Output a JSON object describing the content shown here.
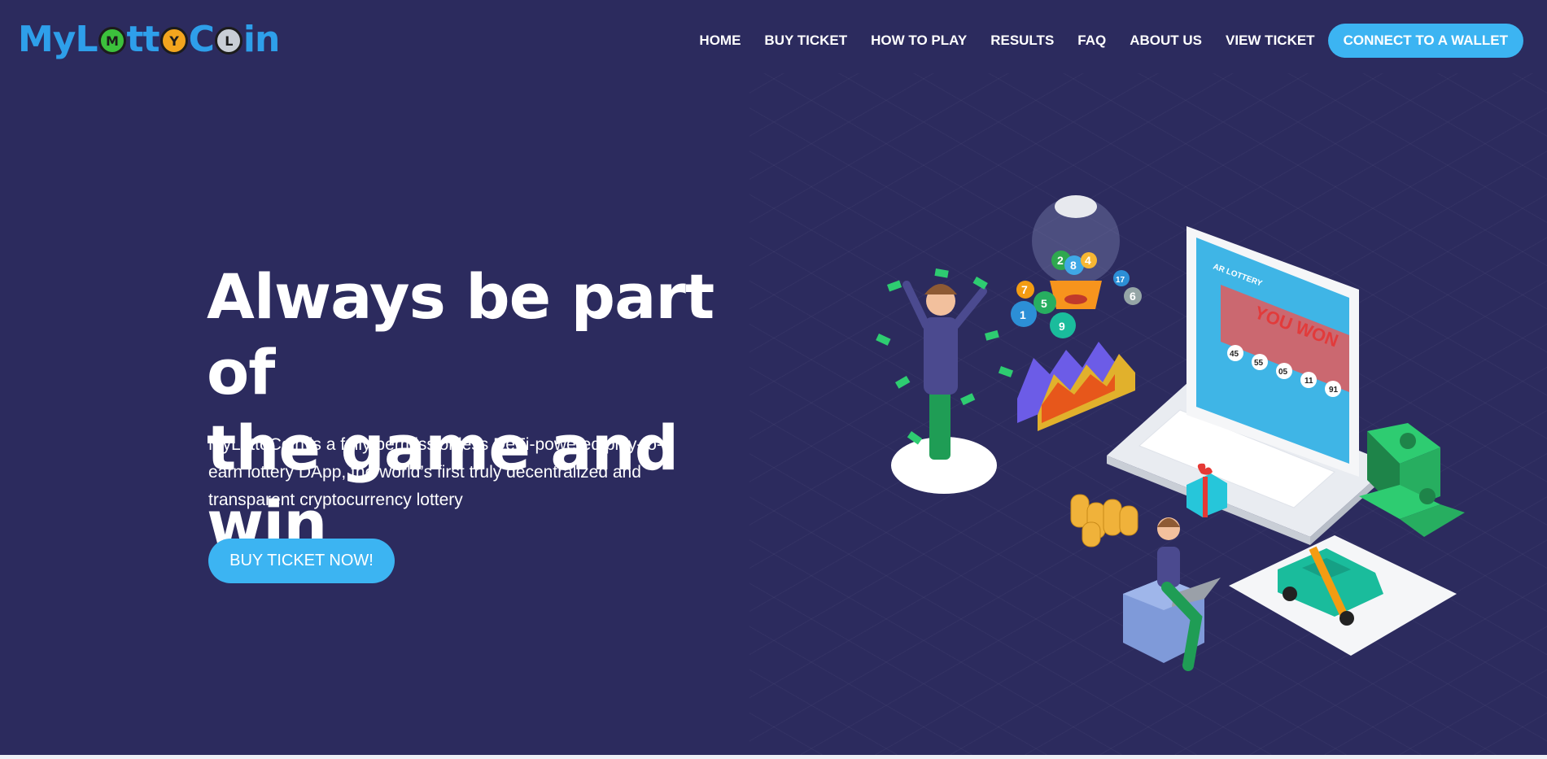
{
  "brand": {
    "prefix": "MyL",
    "coin1": "M",
    "middle": "tt",
    "coin2": "Y",
    "c_letter": "C",
    "coin3": "L",
    "suffix": "in"
  },
  "nav": {
    "items": [
      "HOME",
      "BUY TICKET",
      "HOW TO PLAY",
      "RESULTS",
      "FAQ",
      "ABOUT US",
      "VIEW TICKET"
    ],
    "wallet_label": "CONNECT TO A WALLET"
  },
  "hero": {
    "title_line1": "Always be part of",
    "title_line2": "the game and win",
    "description": "MyLottoCoin is a fully permissionless DeFi-powered play-to-earn lottery DApp, the world’s first truly decentralized and transparent cryptocurrency lottery",
    "cta_label": "BUY TICKET NOW!"
  },
  "illustration": {
    "screen_brand": "AR LOTTERY",
    "screen_message": "YOU WON",
    "winning_numbers": [
      "45",
      "55",
      "05",
      "11",
      "91"
    ],
    "balls": [
      "2",
      "8",
      "4",
      "7",
      "5",
      "1",
      "9",
      "17",
      "6"
    ]
  },
  "colors": {
    "background": "#2c2b5e",
    "accent": "#3cb4f2",
    "logo_blue": "#2e9fea"
  }
}
